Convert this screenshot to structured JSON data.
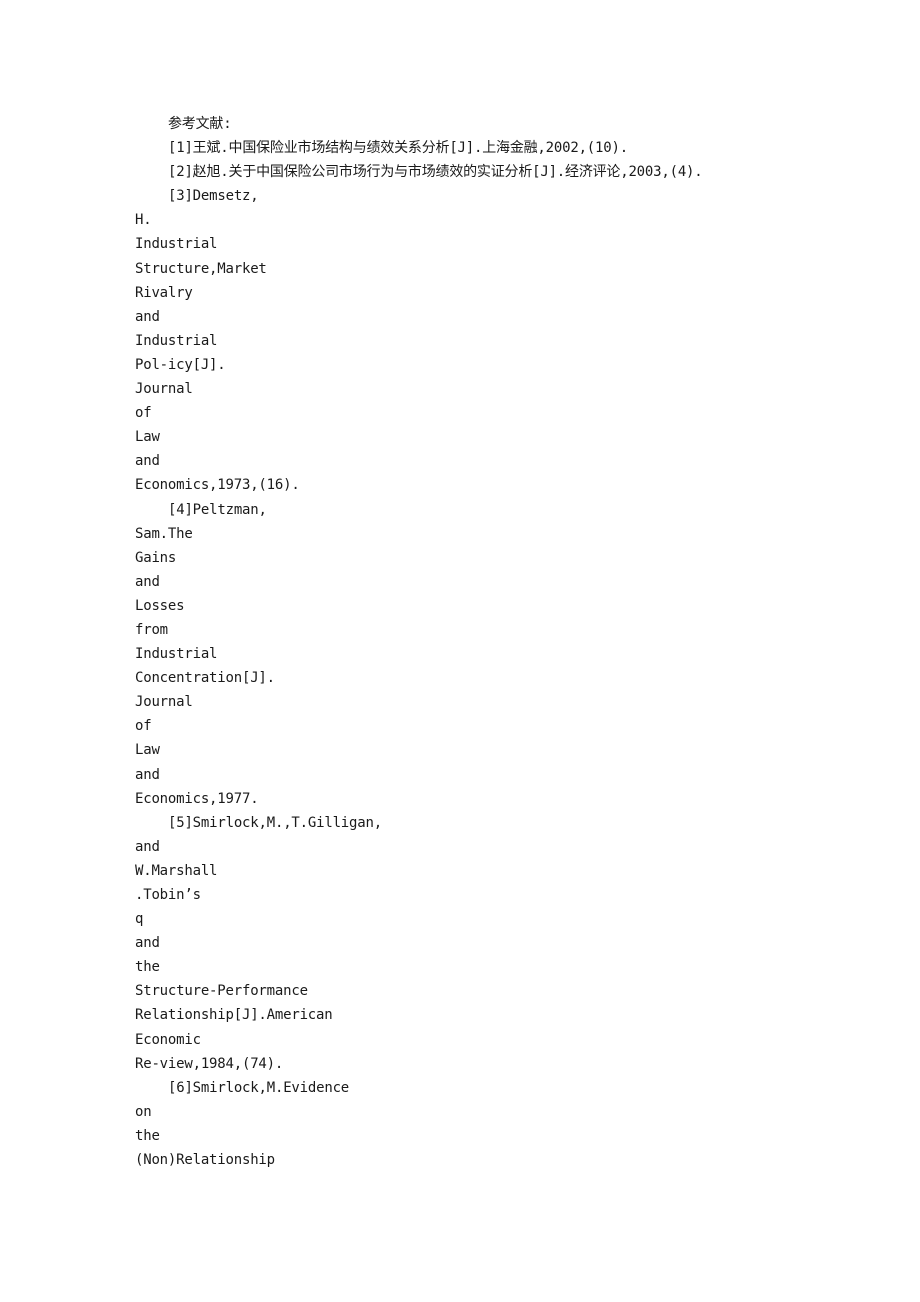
{
  "document": {
    "heading": "参考文献:",
    "references": [
      {
        "id": "ref-1",
        "lines": [
          "[1]王斌.中国保险业市场结构与绩效关系分析[J].上海金融,2002,(10)."
        ]
      },
      {
        "id": "ref-2",
        "lines": [
          "[2]赵旭.关于中国保险公司市场行为与市场绩效的实证分析[J].经济评论,2003,(4)."
        ]
      },
      {
        "id": "ref-3",
        "lines": [
          "[3]Demsetz,",
          "H.",
          "Industrial",
          "Structure,Market",
          "Rivalry",
          "and",
          "Industrial",
          "Pol-icy[J].",
          "Journal",
          "of",
          "Law",
          "and",
          "Economics,1973,(16)."
        ]
      },
      {
        "id": "ref-4",
        "lines": [
          "[4]Peltzman,",
          "Sam.The",
          "Gains",
          "and",
          "Losses",
          "from",
          "Industrial",
          "Concentration[J].",
          "Journal",
          "of",
          "Law",
          "and",
          "Economics,1977."
        ]
      },
      {
        "id": "ref-5",
        "lines": [
          "[5]Smirlock,M.,T.Gilligan,",
          "and",
          "W.Marshall",
          ".Tobin’s",
          "q",
          "and",
          "the",
          "Structure-Performance",
          "Relationship[J].American",
          "Economic",
          "Re-view,1984,(74)."
        ]
      },
      {
        "id": "ref-6",
        "lines": [
          "[6]Smirlock,M.Evidence",
          "on",
          "the",
          "(Non)Relationship"
        ]
      }
    ]
  }
}
